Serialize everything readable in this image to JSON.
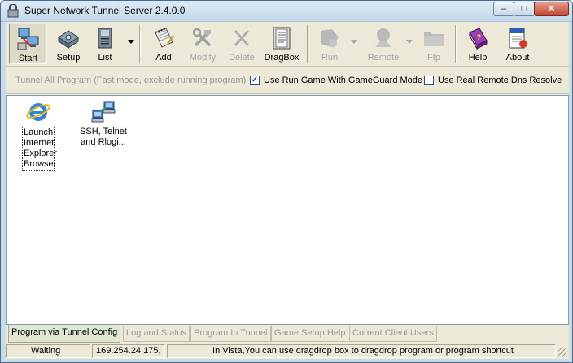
{
  "window": {
    "title": "Super Network Tunnel Server 2.4.0.0",
    "buttons": {
      "minimize": "–",
      "maximize": "□",
      "close": "✕"
    }
  },
  "toolbar": {
    "items": [
      {
        "label": "Start",
        "icon": "network-computer-icon",
        "enabled": true,
        "pressed": true
      },
      {
        "label": "Setup",
        "icon": "setup-icon",
        "enabled": true
      },
      {
        "label": "List",
        "icon": "list-disk-icon",
        "enabled": true,
        "dropdown": true
      },
      {
        "label": "Add",
        "icon": "notepad-add-icon",
        "enabled": true
      },
      {
        "label": "Modify",
        "icon": "tools-icon",
        "enabled": false
      },
      {
        "label": "Delete",
        "icon": "delete-x-icon",
        "enabled": false
      },
      {
        "label": "DragBox",
        "icon": "dragbox-icon",
        "enabled": true
      },
      {
        "label": "Run",
        "icon": "run-icon",
        "enabled": false,
        "dropdown": true
      },
      {
        "label": "Remote",
        "icon": "remote-icon",
        "enabled": false,
        "dropdown": true
      },
      {
        "label": "Ftp",
        "icon": "ftp-folder-icon",
        "enabled": false
      },
      {
        "label": "Help",
        "icon": "help-book-icon",
        "enabled": true
      },
      {
        "label": "About",
        "icon": "about-document-icon",
        "enabled": true
      }
    ]
  },
  "options": {
    "tunnel_all_label": "Tunnel All Program (Fast mode, exclude running program)",
    "gameguard": {
      "label": "Use Run Game With GameGuard Mode",
      "checked": true,
      "mark": "✓"
    },
    "remote_dns": {
      "label": "Use Real Remote Dns Resolve",
      "checked": false,
      "mark": ""
    }
  },
  "programs": [
    {
      "label": "Launch Internet Explorer Browser",
      "icon": "internet-explorer-icon",
      "selected": true
    },
    {
      "label": "SSH, Telnet and Rlogi...",
      "icon": "network-connection-icon",
      "selected": false
    }
  ],
  "tabs": [
    {
      "label": "Program via Tunnel Config",
      "active": true
    },
    {
      "label": "Log and Status",
      "active": false
    },
    {
      "label": "Program In Tunnel",
      "active": false
    },
    {
      "label": "Game Setup Help",
      "active": false
    },
    {
      "label": "Current Client Users",
      "active": false
    }
  ],
  "status": {
    "state": "Waiting",
    "ip": "169.254.24.175, :",
    "message": "In Vista,You can use dragdrop box to dragdrop program or program shortcut"
  }
}
